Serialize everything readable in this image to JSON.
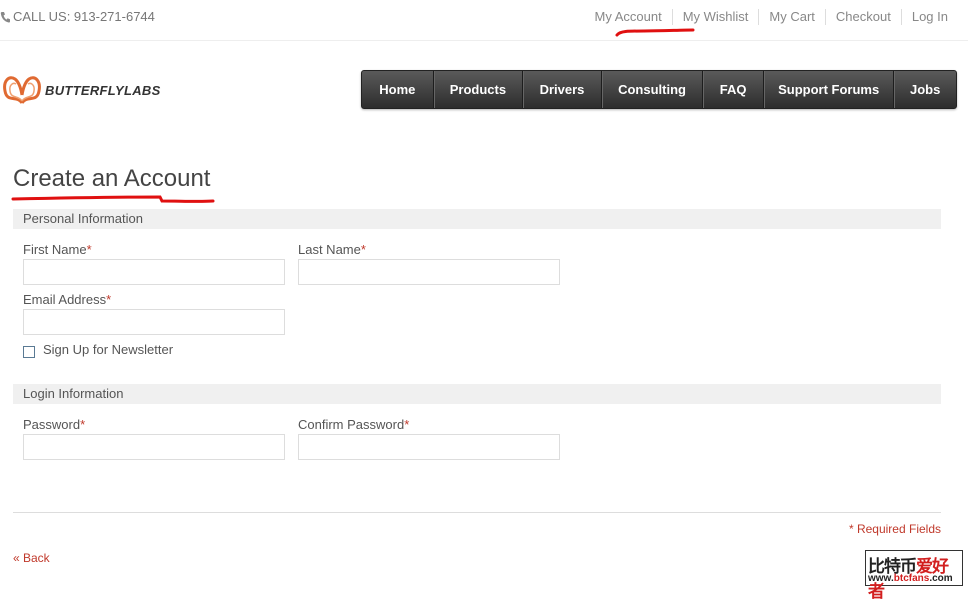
{
  "topbar": {
    "phone": "CALL US: 913-271-6744",
    "links": [
      "My Account",
      "My Wishlist",
      "My Cart",
      "Checkout",
      "Log In"
    ]
  },
  "header": {
    "logo_text": "BUTTERFLYLABS",
    "nav": [
      "Home",
      "Products",
      "Drivers",
      "Consulting",
      "FAQ",
      "Support Forums",
      "Jobs"
    ]
  },
  "page": {
    "title": "Create an Account",
    "personal_section": "Personal Information",
    "first_name_label": "First Name",
    "last_name_label": "Last Name",
    "email_label": "Email Address",
    "newsletter_label": "Sign Up for Newsletter",
    "login_section": "Login Information",
    "password_label": "Password",
    "confirm_password_label": "Confirm Password",
    "required_marker": "*",
    "required_note": "* Required Fields",
    "back_link": "« Back"
  },
  "watermark": {
    "part1": "比特币",
    "part2": "爱好者",
    "url_prefix": "www.",
    "url_brand": "btcfans",
    "url_suffix": ".com"
  },
  "colors": {
    "accent_red": "#c0392b",
    "nav_bg": "#333333",
    "annotation_red": "#e01010"
  }
}
